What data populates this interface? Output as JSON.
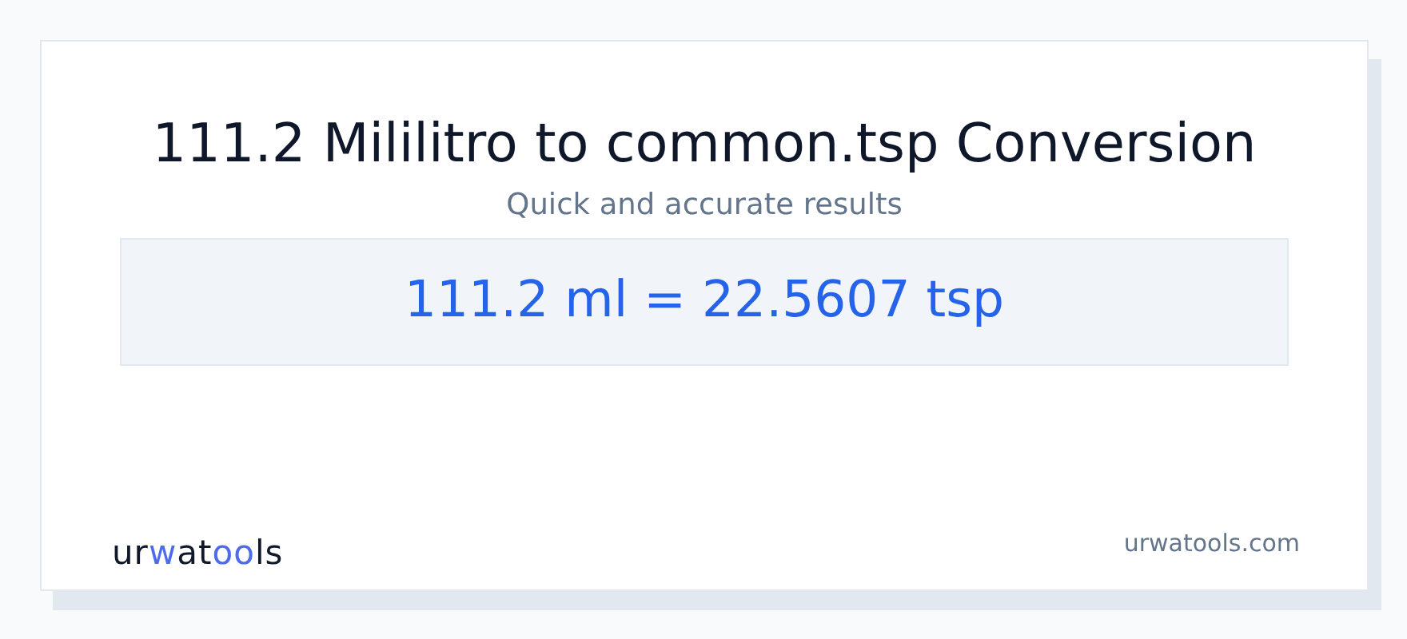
{
  "title": "111.2 Mililitro to common.tsp Conversion",
  "subtitle": "Quick and accurate results",
  "result": "111.2 ml = 22.5607 tsp",
  "logo": [
    {
      "text": "ur",
      "accent": false
    },
    {
      "text": "w",
      "accent": true
    },
    {
      "text": "at",
      "accent": false
    },
    {
      "text": "oo",
      "accent": true
    },
    {
      "text": "ls",
      "accent": false
    }
  ],
  "site": "urwatools.com"
}
